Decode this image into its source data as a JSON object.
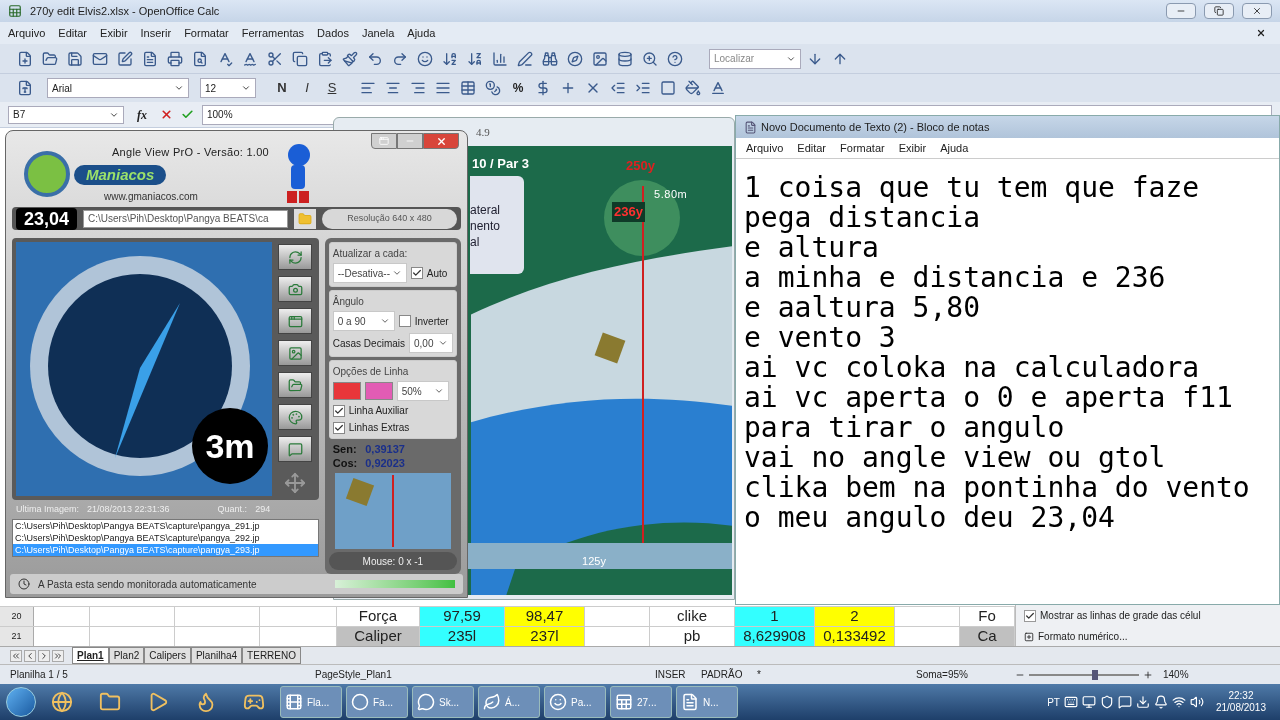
{
  "calc": {
    "title": "270y edit Elvis2.xlsx - OpenOffice Calc",
    "menu": [
      "Arquivo",
      "Editar",
      "Exibir",
      "Inserir",
      "Formatar",
      "Ferramentas",
      "Dados",
      "Janela",
      "Ajuda"
    ],
    "find_placeholder": "Localizar",
    "font_name": "Arial",
    "font_size": "12",
    "format_buttons": [
      "N",
      "I",
      "S"
    ],
    "percent_button": "%",
    "cell_ref": "B7",
    "function_button": "fx",
    "formula": "100%",
    "rows": [
      {
        "number": "20",
        "cells": [
          {
            "color": "#ffffff"
          },
          {
            "color": "#ffffff"
          },
          {
            "color": "#ffffff"
          },
          {
            "color": "#ffffff"
          },
          {
            "text": "Força",
            "color": "#ffffff"
          },
          {
            "text": "97,59",
            "color": "#33ffff"
          },
          {
            "text": "98,47",
            "color": "#ffff00"
          },
          {
            "color": "#ffffff"
          },
          {
            "text": "clike",
            "color": "#ffffff"
          },
          {
            "text": "1",
            "color": "#33ffff"
          },
          {
            "text": "2",
            "color": "#ffff00"
          },
          {
            "color": "#ffffff"
          },
          {
            "text": "Fo",
            "color": "#ffffff"
          }
        ]
      },
      {
        "number": "21",
        "cells": [
          {
            "color": "#ffffff"
          },
          {
            "color": "#ffffff"
          },
          {
            "color": "#ffffff"
          },
          {
            "color": "#ffffff"
          },
          {
            "text": "Caliper",
            "color": "#c0c0c0"
          },
          {
            "text": "235l",
            "color": "#33ffff"
          },
          {
            "text": "237l",
            "color": "#ffff00"
          },
          {
            "color": "#ffffff"
          },
          {
            "text": "pb",
            "color": "#ffffff"
          },
          {
            "text": "8,629908",
            "color": "#33ffff"
          },
          {
            "text": "0,133492",
            "color": "#ffff00"
          },
          {
            "color": "#ffffff"
          },
          {
            "text": "Ca",
            "color": "#c0c0c0"
          }
        ]
      }
    ],
    "sidebar": {
      "grid_lines": {
        "label": "Mostrar as linhas de grade das célul",
        "checked": true
      },
      "number_format": {
        "label": "Formato numérico...",
        "expanded": false
      }
    },
    "sheet_tabs": [
      {
        "label": "Plan1",
        "selected": true
      },
      {
        "label": "Plan2",
        "selected": false
      },
      {
        "label": "Calipers",
        "selected": false
      },
      {
        "label": "Planilha4",
        "selected": false
      },
      {
        "label": "TERRENO",
        "selected": false
      }
    ],
    "status": {
      "sheet": "Planilha 1 / 5",
      "page_style": "PageStyle_Plan1",
      "insert_mode": "INSER",
      "selection_mode": "PADRÃO",
      "modified": "*",
      "sum": "Soma=95%",
      "zoom": "140%",
      "zoom_slider": {
        "level": 0.6
      }
    }
  },
  "angle_view": {
    "title": "Angle View PrO - Versão: 1.00",
    "logo_text": "Maniacos",
    "website": "www.gmaniacos.com",
    "angle": "23,04",
    "path": "C:\\Users\\Pih\\Desktop\\Pangya BEATS\\ca",
    "resolution": "Resolução 640 x 480",
    "preview_label": "3m",
    "update": {
      "legend": "Atualizar a cada:",
      "interval": "--Desativa--",
      "auto": {
        "label": "Auto",
        "checked": true
      }
    },
    "angle_group": {
      "legend": "Ângulo",
      "range": "0 a 90",
      "invert": {
        "label": "Inverter",
        "checked": false
      },
      "decimals_label": "Casas Decimais",
      "decimals": "0,00"
    },
    "line_options": {
      "legend": "Opções de Linha",
      "swatches": [
        {
          "color": "#e8363a"
        },
        {
          "color": "#e25cb4"
        }
      ],
      "opacity": "50%",
      "checks": [
        {
          "label": "Linha Auxiliar",
          "checked": true
        },
        {
          "label": "Linhas Extras",
          "checked": true
        }
      ]
    },
    "sen_label": "Sen:",
    "sen": "0,39137",
    "cos_label": "Cos:",
    "cos": "0,92023",
    "mouse": "Mouse: 0 x -1",
    "last_image_label": "Ultima Imagem:",
    "last_image": "21/08/2013 22:31:36",
    "count_label": "Quant.:",
    "count": "294",
    "files": [
      {
        "path": "C:\\Users\\Pih\\Desktop\\Pangya BEATS\\capture\\pangya_291.jp",
        "selected": false
      },
      {
        "path": "C:\\Users\\Pih\\Desktop\\Pangya BEATS\\capture\\pangya_292.jp",
        "selected": false
      },
      {
        "path": "C:\\Users\\Pih\\Desktop\\Pangya BEATS\\capture\\pangya_293.jp",
        "selected": true
      }
    ],
    "status": "A Pasta esta sendo monitorada automaticamente",
    "monitor_progress": {
      "level": 1
    }
  },
  "game": {
    "title": "4.9",
    "hole": "10 / Par 3",
    "menu_fragments": [
      "ateral",
      "nento",
      "al"
    ],
    "pin_distance": "250y",
    "height": "5.80m",
    "ball_distance": "236y",
    "ruler": "125y"
  },
  "notepad": {
    "title": "Novo Documento de Texto (2) - Bloco de notas",
    "menu": [
      "Arquivo",
      "Editar",
      "Formatar",
      "Exibir",
      "Ajuda"
    ],
    "lines": [
      "1 coisa que tu tem que faze",
      "pega distancia",
      "e altura",
      "a minha e distancia e 236",
      "e aaltura 5,80",
      "e vento 3",
      "ai vc coloka na calculadora",
      "ai vc aperta o 0 e aperta f11",
      "para tirar o angulo",
      "vai no angle view ou gtol",
      "clika bem na pontinha do vento",
      "o meu angulo deu 23,04"
    ]
  },
  "taskbar": {
    "tasks": [
      "Fla...",
      "Fa...",
      "Sk...",
      "Á...",
      "Pa...",
      "27...",
      "N..."
    ],
    "language": "PT",
    "time": "22:32",
    "date": "21/08/2013"
  }
}
